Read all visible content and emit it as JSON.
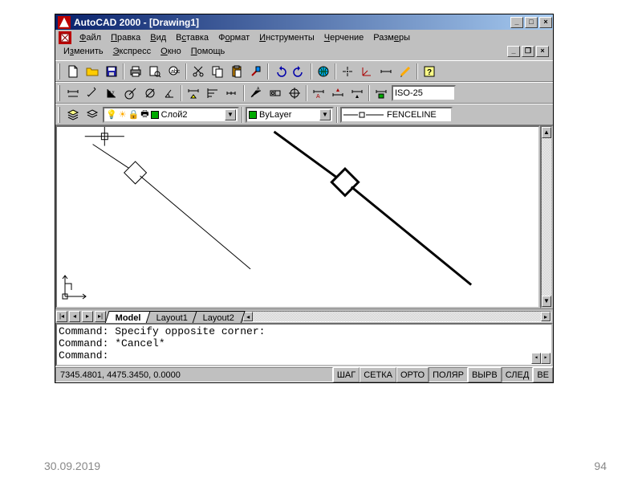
{
  "title": "AutoCAD 2000 - [Drawing1]",
  "menu": [
    "Файл",
    "Правка",
    "Вид",
    "Вставка",
    "Формат",
    "Инструменты",
    "Черчение",
    "Размеры",
    "Изменить",
    "Экспресс",
    "Окно",
    "Помощь"
  ],
  "dimstyle": "ISO-25",
  "layer": {
    "label": "Слой2"
  },
  "bylayer": "ByLayer",
  "linetype": "FENCELINE",
  "tabs": [
    "Model",
    "Layout1",
    "Layout2"
  ],
  "command_lines": [
    "Command: Specify opposite corner:",
    "Command: *Cancel*",
    "Command:"
  ],
  "status_coords": "7345.4801, 4475.3450, 0.0000",
  "status_buttons": [
    "ШАГ",
    "СЕТКА",
    "ОРТО",
    "ПОЛЯР",
    "ВЫРВ",
    "СЛЕД",
    "ВЕ"
  ],
  "footer_date": "30.09.2019",
  "footer_page": "94",
  "icons": {
    "new": "new-file-icon",
    "open": "open-folder-icon",
    "save": "save-disk-icon",
    "print": "printer-icon",
    "preview": "print-preview-icon",
    "find": "find-icon",
    "cut": "scissors-icon",
    "copy": "copy-icon",
    "paste": "paste-icon",
    "match": "match-prop-icon",
    "undo": "undo-icon",
    "redo": "redo-icon",
    "hyper": "globe-icon",
    "track": "tracking-icon",
    "ucs": "ucs-icon",
    "dist": "distance-icon",
    "redraw": "redraw-icon",
    "help": "help-icon"
  }
}
